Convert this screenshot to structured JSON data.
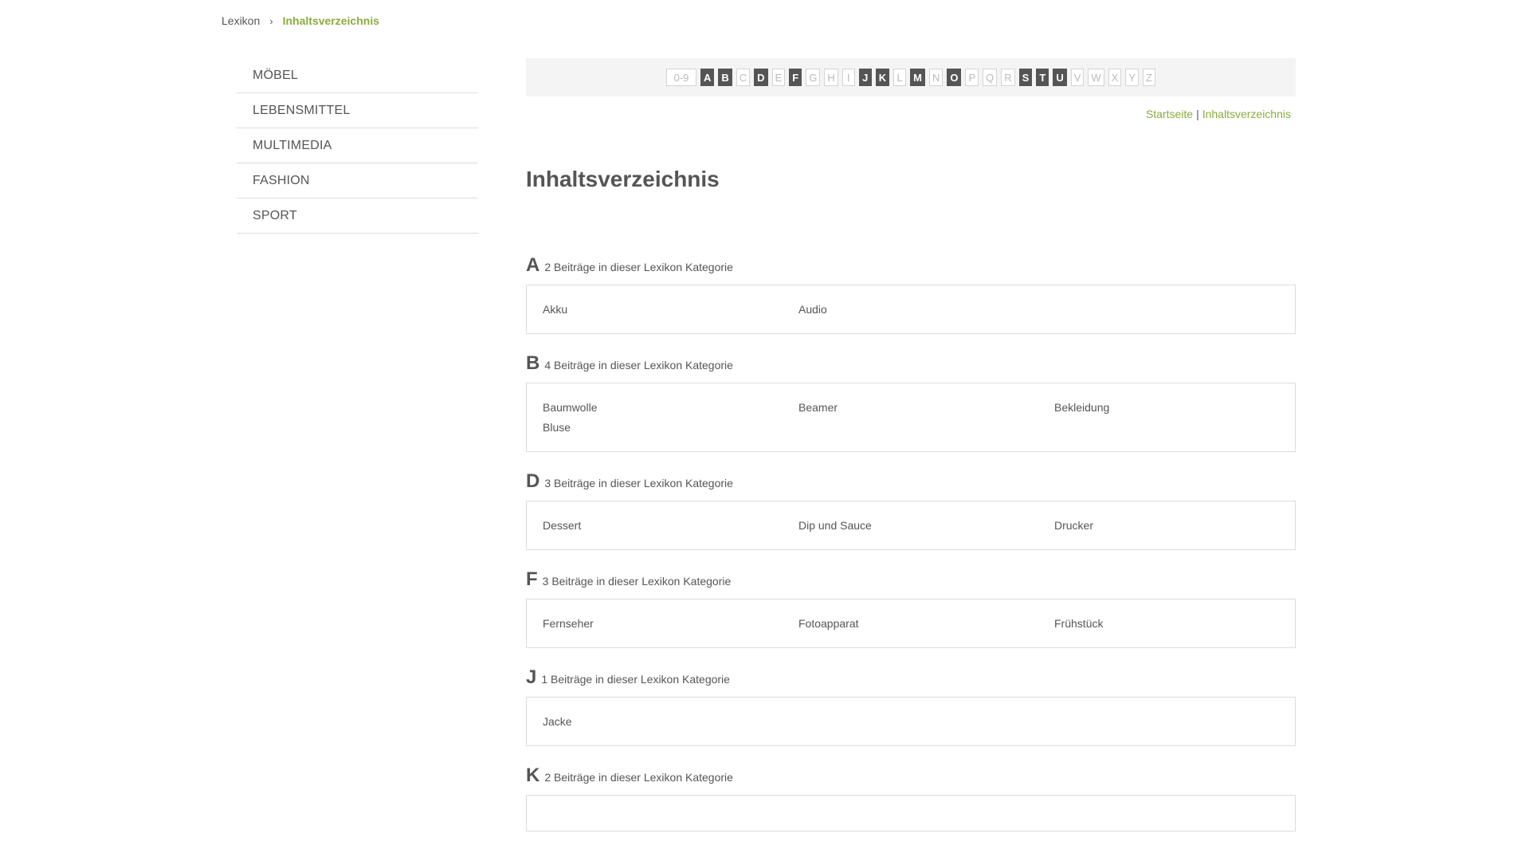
{
  "breadcrumb": {
    "root": "Lexikon",
    "current": "Inhaltsverzeichnis"
  },
  "sidebar": {
    "items": [
      "MÖBEL",
      "LEBENSMITTEL",
      "MULTIMEDIA",
      "FASHION",
      "SPORT"
    ]
  },
  "alphabet": [
    {
      "label": "0-9",
      "active": false
    },
    {
      "label": "A",
      "active": true
    },
    {
      "label": "B",
      "active": true
    },
    {
      "label": "C",
      "active": false
    },
    {
      "label": "D",
      "active": true
    },
    {
      "label": "E",
      "active": false
    },
    {
      "label": "F",
      "active": true
    },
    {
      "label": "G",
      "active": false
    },
    {
      "label": "H",
      "active": false
    },
    {
      "label": "I",
      "active": false
    },
    {
      "label": "J",
      "active": true
    },
    {
      "label": "K",
      "active": true
    },
    {
      "label": "L",
      "active": false
    },
    {
      "label": "M",
      "active": true
    },
    {
      "label": "N",
      "active": false
    },
    {
      "label": "O",
      "active": true
    },
    {
      "label": "P",
      "active": false
    },
    {
      "label": "Q",
      "active": false
    },
    {
      "label": "R",
      "active": false
    },
    {
      "label": "S",
      "active": true
    },
    {
      "label": "T",
      "active": true
    },
    {
      "label": "U",
      "active": true
    },
    {
      "label": "V",
      "active": false
    },
    {
      "label": "W",
      "active": false
    },
    {
      "label": "X",
      "active": false
    },
    {
      "label": "Y",
      "active": false
    },
    {
      "label": "Z",
      "active": false
    }
  ],
  "toplinks": {
    "home": "Startseite",
    "separator": "|",
    "current": "Inhaltsverzeichnis"
  },
  "page": {
    "title": "Inhaltsverzeichnis"
  },
  "sections": [
    {
      "letter": "A",
      "count": "2 Beiträge in dieser Lexikon Kategorie",
      "entries": [
        "Akku",
        "Audio"
      ]
    },
    {
      "letter": "B",
      "count": "4 Beiträge in dieser Lexikon Kategorie",
      "entries": [
        "Baumwolle",
        "Beamer",
        "Bekleidung",
        "Bluse"
      ]
    },
    {
      "letter": "D",
      "count": "3 Beiträge in dieser Lexikon Kategorie",
      "entries": [
        "Dessert",
        "Dip und Sauce",
        "Drucker"
      ]
    },
    {
      "letter": "F",
      "count": "3 Beiträge in dieser Lexikon Kategorie",
      "entries": [
        "Fernseher",
        "Fotoapparat",
        "Frühstück"
      ]
    },
    {
      "letter": "J",
      "count": "1 Beiträge in dieser Lexikon Kategorie",
      "entries": [
        "Jacke"
      ]
    },
    {
      "letter": "K",
      "count": "2 Beiträge in dieser Lexikon Kategorie",
      "entries": []
    }
  ]
}
